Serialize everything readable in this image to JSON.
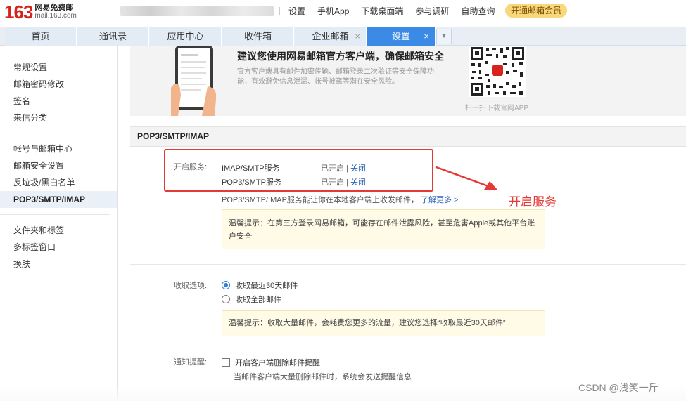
{
  "header": {
    "logo_number": "163",
    "logo_title": "网易免费邮",
    "logo_url": "mail.163.com",
    "links": [
      "设置",
      "手机App",
      "下载桌面端",
      "参与调研",
      "自助查询"
    ],
    "vip_button": "开通邮箱会员"
  },
  "tabs": [
    {
      "label": "首页"
    },
    {
      "label": "通讯录"
    },
    {
      "label": "应用中心"
    },
    {
      "label": "收件箱"
    },
    {
      "label": "企业邮箱",
      "close": "×"
    },
    {
      "label": "设置",
      "close": "×"
    }
  ],
  "sidebar": {
    "group1": [
      "常规设置",
      "邮箱密码修改",
      "签名",
      "来信分类"
    ],
    "group2": [
      "帐号与邮箱中心",
      "邮箱安全设置",
      "反垃圾/黑白名单",
      "POP3/SMTP/IMAP"
    ],
    "group3": [
      "文件夹和标签",
      "多标签窗口",
      "换肤"
    ],
    "active": "POP3/SMTP/IMAP"
  },
  "promo": {
    "title": "建议您使用网易邮箱官方客户端，确保邮箱安全",
    "desc": "官方客户端具有邮件加密传输、邮箱登录二次验证等安全保障功能，有效避免信息泄漏、帐号被盗等潜在安全风险。",
    "qr_caption": "扫一扫下载官网APP",
    "qr_badge": "邮"
  },
  "section": {
    "title": "POP3/SMTP/IMAP",
    "service_label": "开启服务:",
    "services": [
      {
        "name": "IMAP/SMTP服务",
        "status": "已开启",
        "sep": "|",
        "action": "关闭"
      },
      {
        "name": "POP3/SMTP服务",
        "status": "已开启",
        "sep": "|",
        "action": "关闭"
      }
    ],
    "info": "POP3/SMTP/IMAP服务能让你在本地客户端上收发邮件，",
    "info_link": "了解更多 >",
    "tip1": "温馨提示：在第三方登录网易邮箱，可能存在邮件泄露风险，甚至危害Apple或其他平台账户安全",
    "receive_label": "收取选项:",
    "receive_options": [
      {
        "label": "收取最近30天邮件",
        "checked": true
      },
      {
        "label": "收取全部邮件",
        "checked": false
      }
    ],
    "tip2": "温馨提示：收取大量邮件，会耗费您更多的流量，建议您选择“收取最近30天邮件”",
    "notify_label": "通知提醒:",
    "notify_checkbox": "开启客户端删除邮件提醒",
    "notify_desc": "当邮件客户端大量删除邮件时，系统会发送提醒信息"
  },
  "annotation": {
    "text": "开启服务",
    "color": "#e53935"
  },
  "watermark": "CSDN @浅笑一斤",
  "colors": {
    "brand_red": "#d7231e",
    "tab_active": "#3b8ae6",
    "link": "#2a62b8",
    "tip_bg": "#fffbe7"
  }
}
